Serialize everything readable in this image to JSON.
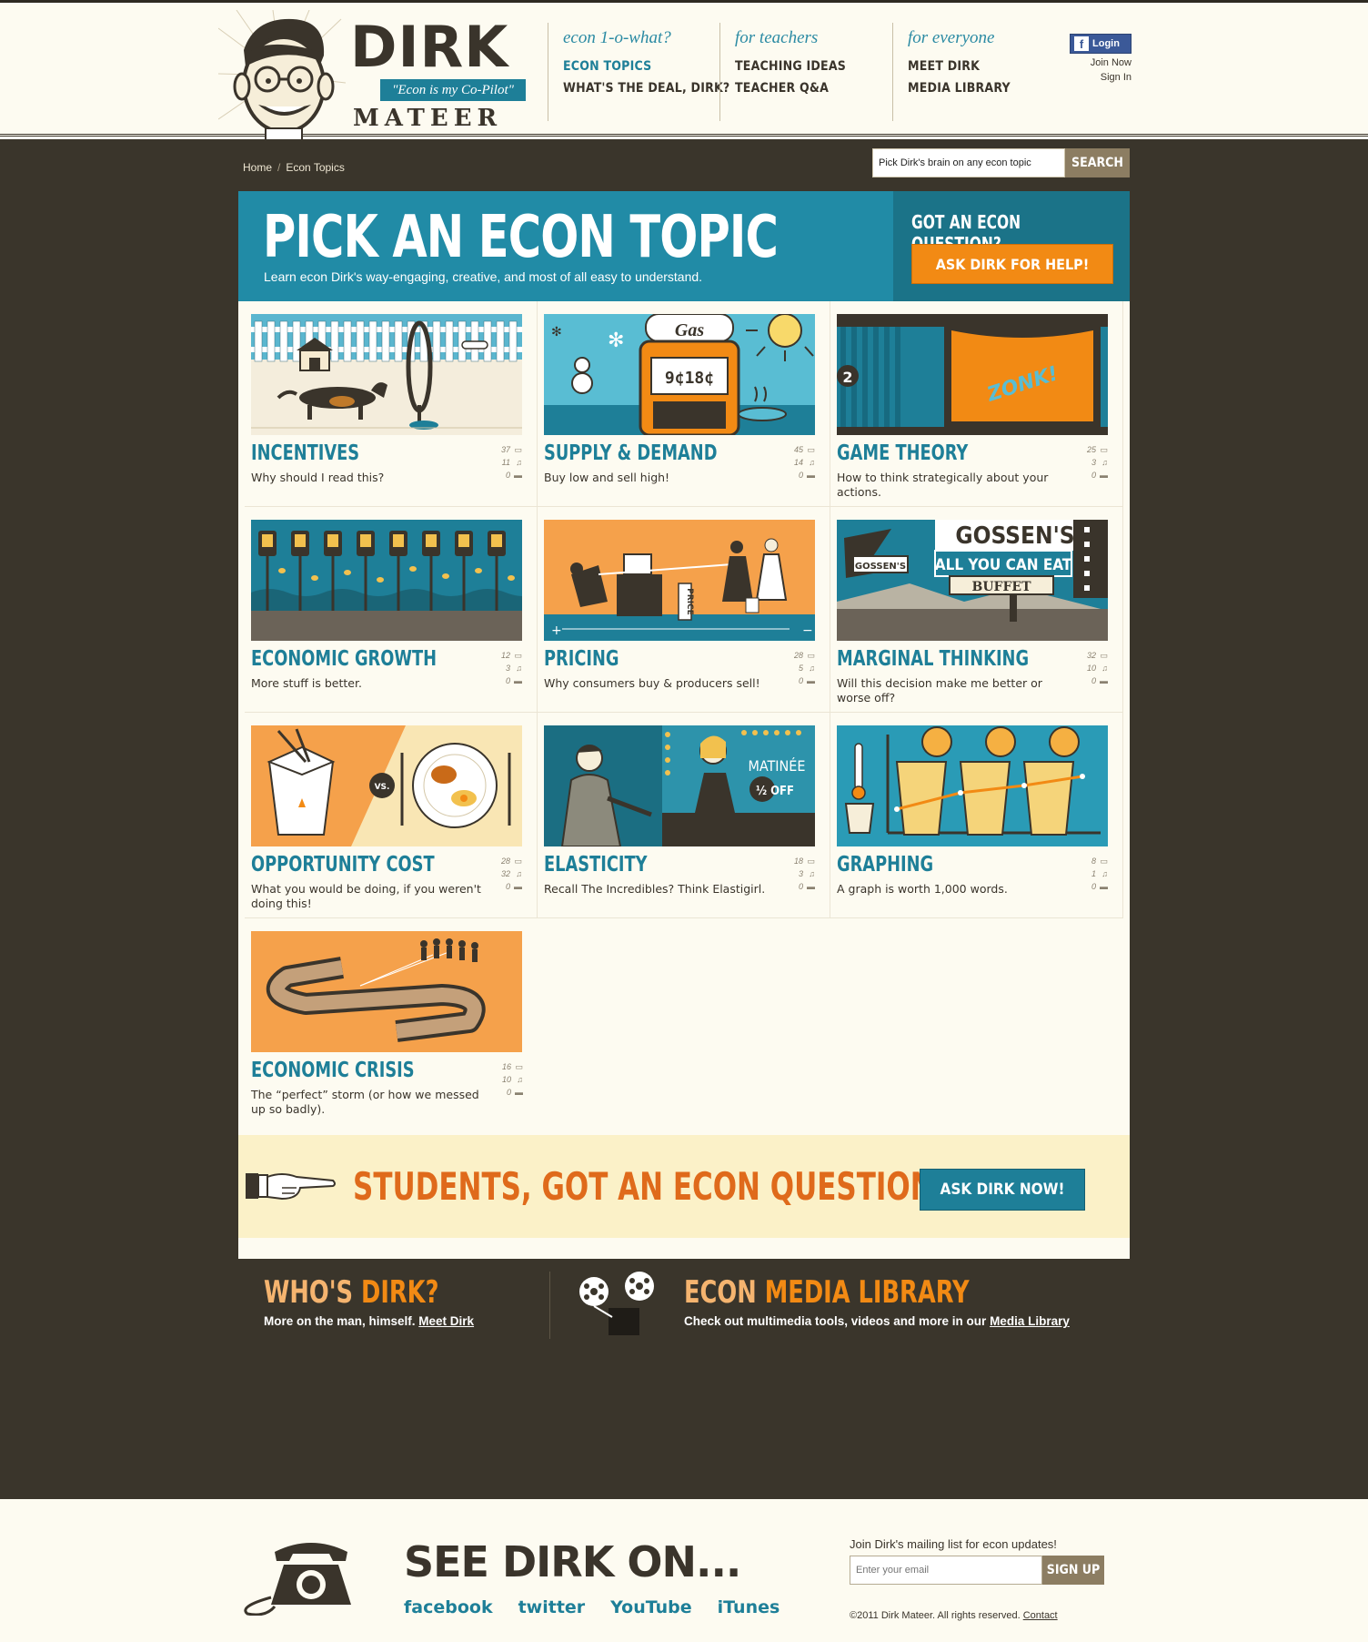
{
  "brand": {
    "name_top": "DIRK",
    "tagline": "\"Econ is my Co-Pilot\"",
    "name_bottom": "MATEER"
  },
  "nav": [
    {
      "title": "econ 1-o-what?",
      "links": [
        "ECON TOPICS",
        "WHAT'S THE DEAL, DIRK?"
      ]
    },
    {
      "title": "for teachers",
      "links": [
        "TEACHING IDEAS",
        "TEACHER Q&A"
      ]
    },
    {
      "title": "for everyone",
      "links": [
        "MEET DIRK",
        "MEDIA LIBRARY"
      ]
    }
  ],
  "account": {
    "login_label": "Login",
    "join": "Join Now",
    "signin": "Sign In"
  },
  "breadcrumb": [
    "Home",
    "Econ Topics"
  ],
  "search": {
    "value": "Pick Dirk's brain on any econ topic",
    "button": "SEARCH"
  },
  "hero": {
    "title": "PICK AN ECON TOPIC",
    "subtitle": "Learn econ Dirk's way-engaging, creative, and most of all easy to understand.",
    "question": "GOT AN ECON QUESTION?",
    "cta": "ASK DIRK FOR HELP!"
  },
  "topics": [
    {
      "title": "INCENTIVES",
      "desc": "Why should I read this?",
      "stats": [
        "37",
        "11",
        "0"
      ],
      "bg": "#f4eddc",
      "accent": "#1e7f98"
    },
    {
      "title": "SUPPLY & DEMAND",
      "desc": "Buy low and sell high!",
      "stats": [
        "45",
        "14",
        "0"
      ],
      "bg": "#59bdd3",
      "accent": "#f28a14"
    },
    {
      "title": "GAME THEORY",
      "desc": "How to think strategically about your actions.",
      "stats": [
        "25",
        "3",
        "0"
      ],
      "bg": "#1e7f98",
      "accent": "#f28a14"
    },
    {
      "title": "ECONOMIC GROWTH",
      "desc": "More stuff is better.",
      "stats": [
        "12",
        "3",
        "0"
      ],
      "bg": "#1e7f98",
      "accent": "#f2c14e"
    },
    {
      "title": "PRICING",
      "desc": "Why consumers buy & producers sell!",
      "stats": [
        "28",
        "5",
        "0"
      ],
      "bg": "#f5a14b",
      "accent": "#1e7f98"
    },
    {
      "title": "MARGINAL THINKING",
      "desc": "Will this decision make me better or worse off?",
      "stats": [
        "32",
        "10",
        "0"
      ],
      "bg": "#1e7f98",
      "accent": "#ffffff"
    },
    {
      "title": "OPPORTUNITY COST",
      "desc": "What you would be doing, if you weren't doing this!",
      "stats": [
        "28",
        "32",
        "0"
      ],
      "bg": "#f5a14b",
      "accent": "#f9e6b4"
    },
    {
      "title": "ELASTICITY",
      "desc": "Recall The Incredibles? Think Elastigirl.",
      "stats": [
        "18",
        "3",
        "0"
      ],
      "bg": "#1b6e82",
      "accent": "#f2c14e"
    },
    {
      "title": "GRAPHING",
      "desc": "A graph is worth 1,000 words.",
      "stats": [
        "8",
        "1",
        "0"
      ],
      "bg": "#2a9bb6",
      "accent": "#f5b042"
    },
    {
      "title": "ECONOMIC CRISIS",
      "desc": "The “perfect” storm (or how we messed up so badly).",
      "stats": [
        "16",
        "10",
        "0"
      ],
      "bg": "#f5a14b",
      "accent": "#6b5b45"
    }
  ],
  "img_text": {
    "gas": "Gas",
    "price_digits": "9¢18¢",
    "zonk": "ZONK!",
    "game_num": "2",
    "price_tag": "PRICE",
    "gossens": "GOSSEN'S",
    "all_you_can_eat": "ALL YOU CAN EAT",
    "buffet": "BUFFET",
    "vs": "VS.",
    "matinee": "MATINÉE",
    "half_off": "½ OFF"
  },
  "students_banner": {
    "text": "STUDENTS, GOT AN ECON QUESTION?",
    "cta": "ASK DIRK NOW!"
  },
  "promos": {
    "whos_a": "WHO'S ",
    "whos_b": "DIRK?",
    "whos_sub": "More on the man, himself. ",
    "whos_link": "Meet Dirk",
    "media_a": "ECON ",
    "media_b": "MEDIA LIBRARY",
    "media_sub": "Check out multimedia tools, videos and more in our ",
    "media_link": "Media Library"
  },
  "footer": {
    "see_dirk": "SEE DIRK ON...",
    "social": [
      "facebook",
      "twitter",
      "YouTube",
      "iTunes"
    ],
    "mail_title": "Join Dirk's mailing list for econ updates!",
    "mail_placeholder": "Enter your email",
    "signup": "SIGN UP",
    "copyright": "©2011 Dirk Mateer. All rights reserved. ",
    "contact": "Contact"
  },
  "colors": {
    "teal": "#1e7f98",
    "orange": "#f28a14",
    "dark_bg": "#3a352b",
    "cream": "#fdfbf1"
  }
}
